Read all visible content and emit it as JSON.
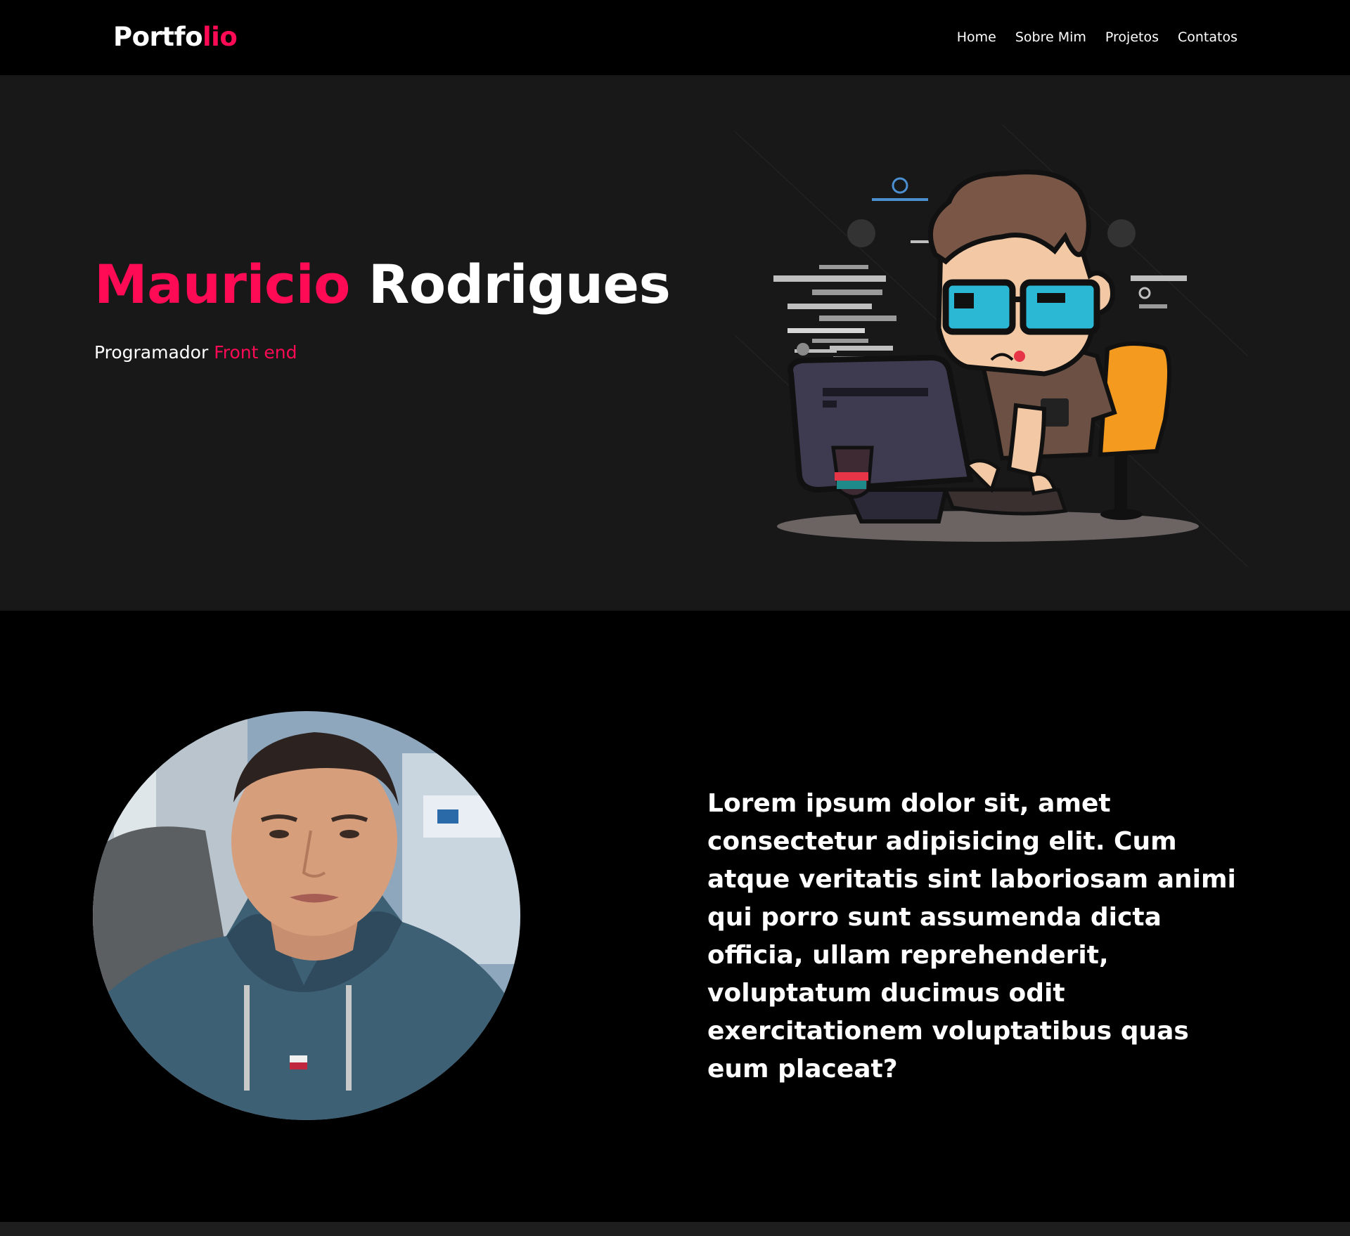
{
  "header": {
    "logo_part1": "Portfo",
    "logo_part2": "lio",
    "nav": [
      {
        "label": "Home"
      },
      {
        "label": "Sobre Mim"
      },
      {
        "label": "Projetos"
      },
      {
        "label": "Contatos"
      }
    ]
  },
  "hero": {
    "first_name": "Mauricio",
    "last_name": "Rodrigues",
    "role_part1": "Programador",
    "role_part2": "Front end",
    "illustration": "programmer-cartoon-illustration"
  },
  "about": {
    "photo": "profile-photo",
    "text": "Lorem ipsum dolor sit, amet consectetur adipisicing elit. Cum atque veritatis sint laboriosam animi qui porro sunt assumenda dicta officia, ullam reprehenderit, voluptatum ducimus odit exercitationem voluptatibus quas eum placeat?"
  },
  "colors": {
    "accent": "#ff0a55",
    "header_bg": "#000000",
    "hero_bg": "#181818",
    "about_bg": "#000000"
  }
}
